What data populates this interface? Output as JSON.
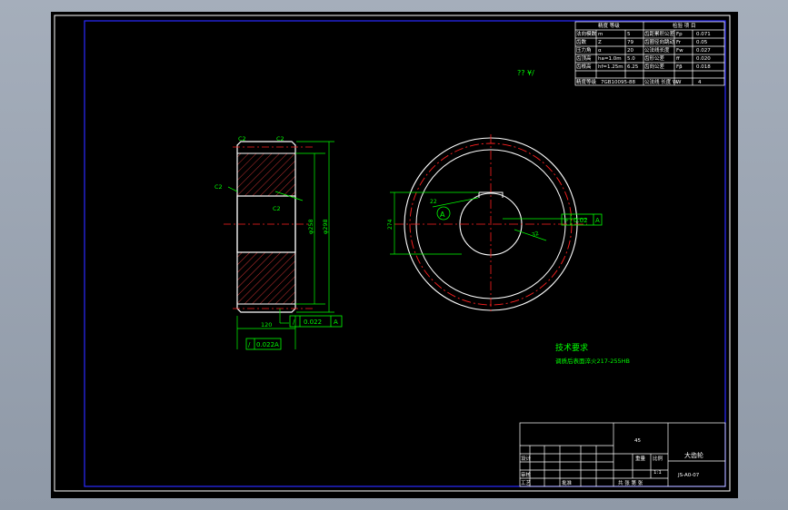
{
  "drawing": {
    "technical_requirements_title": "技术要求",
    "technical_requirements_text": "调质后表面淬火217-255HB",
    "annotation_top": "?? ¥/",
    "datum_label": "A"
  },
  "side_view": {
    "chamfer_left": "C2",
    "chamfer_right": "C2",
    "chamfer_outer": "C2",
    "chamfer_inner": "C2",
    "dim_width": "120",
    "dim_bore": "φ258",
    "dim_outer": "φ298",
    "tolerance_flatness": "0.022",
    "tolerance_runout": "0.022",
    "tolerance_datum": "A"
  },
  "front_view": {
    "dim_keyway_depth": "274",
    "dim_keyway_width": "22",
    "dim_keyway_tol": "32",
    "tolerance_sym": "0.02",
    "tolerance_datum": "A"
  },
  "param_table": {
    "header_left": "精度 等级",
    "header_right": "检验 项 目",
    "rows": [
      [
        "法向模数",
        "m",
        "5",
        "齿距累积公差",
        "Fp",
        "0.071"
      ],
      [
        "齿数",
        "Z",
        "79",
        "齿圈径向跳动",
        "Fr",
        "0.05"
      ],
      [
        "压力角",
        "α",
        "20",
        "公法线长度",
        "Fw",
        "0.027"
      ],
      [
        "齿顶高",
        "ha=1.0m",
        "5.0",
        "齿形公差",
        "ff",
        "0.020"
      ],
      [
        "齿根高",
        "hf=1.25m",
        "6.25",
        "齿向公差",
        "Fβ",
        "0.018"
      ]
    ],
    "footer": [
      "精度等级",
      "7GB10095-88",
      "",
      "公法线 长度 W",
      "W",
      "4"
    ]
  },
  "title_block": {
    "material": "45",
    "part_name": "大齿轮",
    "drawing_no": "JS-A0-07",
    "scale_label": "比例",
    "scale_value": "1:1",
    "weight_label": "重量",
    "designer": "设计",
    "checker": "审核",
    "process": "工艺",
    "approve": "批准",
    "sheet_info": "共 张 第 张"
  }
}
